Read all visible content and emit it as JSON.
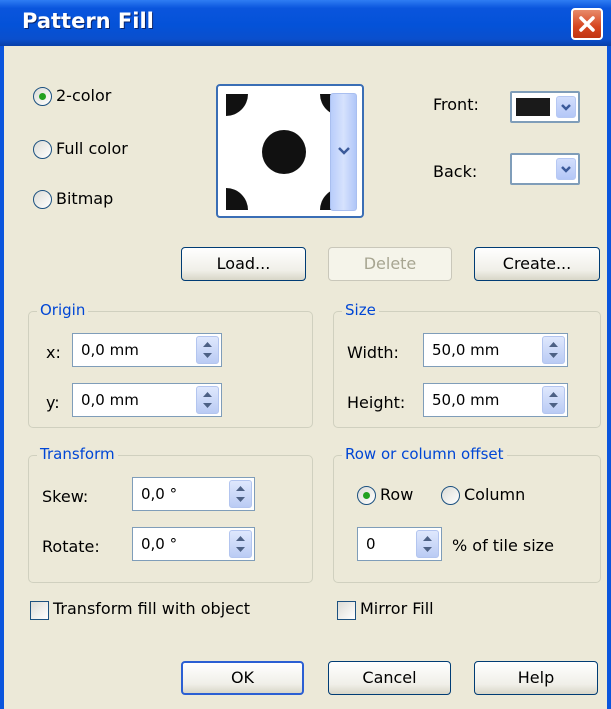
{
  "window": {
    "title": "Pattern Fill"
  },
  "mode": {
    "options": [
      {
        "label": "2-color",
        "selected": true
      },
      {
        "label": "Full color",
        "selected": false
      },
      {
        "label": "Bitmap",
        "selected": false
      }
    ]
  },
  "colors": {
    "front_label": "Front:",
    "back_label": "Back:",
    "front_value": "#1a1a1a",
    "back_value": "#ffffff"
  },
  "buttons": {
    "load": "Load...",
    "delete": "Delete",
    "create": "Create...",
    "ok": "OK",
    "cancel": "Cancel",
    "help": "Help"
  },
  "origin": {
    "label": "Origin",
    "x_label": "x:",
    "x_value": "0,0 mm",
    "y_label": "y:",
    "y_value": "0,0 mm"
  },
  "size": {
    "label": "Size",
    "width_label": "Width:",
    "width_value": "50,0 mm",
    "height_label": "Height:",
    "height_value": "50,0 mm"
  },
  "transform": {
    "label": "Transform",
    "skew_label": "Skew:",
    "skew_value": "0,0 °",
    "rotate_label": "Rotate:",
    "rotate_value": "0,0 °"
  },
  "offset": {
    "label": "Row or column offset",
    "row_label": "Row",
    "column_label": "Column",
    "row_selected": true,
    "percent_value": "0",
    "percent_suffix": "% of tile size"
  },
  "checks": {
    "transform_fill": "Transform fill with object",
    "mirror_fill": "Mirror Fill"
  },
  "accent_colors": {
    "title_bar": "#0a55dd",
    "group_label": "#0046d5",
    "close_button": "#d6451f"
  }
}
